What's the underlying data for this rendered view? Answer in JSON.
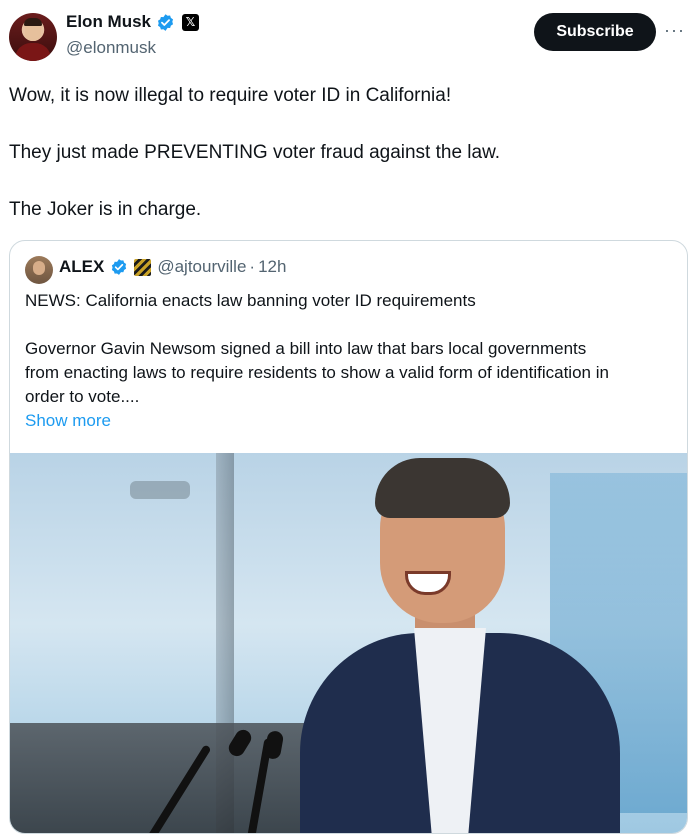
{
  "author": {
    "name": "Elon Musk",
    "handle": "@elonmusk",
    "verified_badge_icon": "verified-check-icon",
    "affiliation_badge_icon": "x-logo-icon"
  },
  "actions": {
    "subscribe_label": "Subscribe",
    "more_icon": "more-dots-icon",
    "more_label": "···"
  },
  "tweet": {
    "lines": [
      "Wow, it is now illegal to require voter ID in California!",
      "They just made PREVENTING voter fraud against the law.",
      "The Joker is in charge."
    ]
  },
  "quote": {
    "name": "ALEX",
    "handle": "@ajtourville",
    "separator": "·",
    "time": "12h",
    "headline": "NEWS: California enacts law banning voter ID requirements",
    "body_lines": [
      "Governor Gavin Newsom signed a bill into law that bars local governments",
      "from enacting laws to require residents to show a valid form of identification in",
      "order to vote...."
    ],
    "show_more": "Show more"
  },
  "colors": {
    "verified_blue": "#1d9bf0",
    "text": "#0f1419",
    "secondary": "#536471",
    "border": "#cfd9de"
  }
}
